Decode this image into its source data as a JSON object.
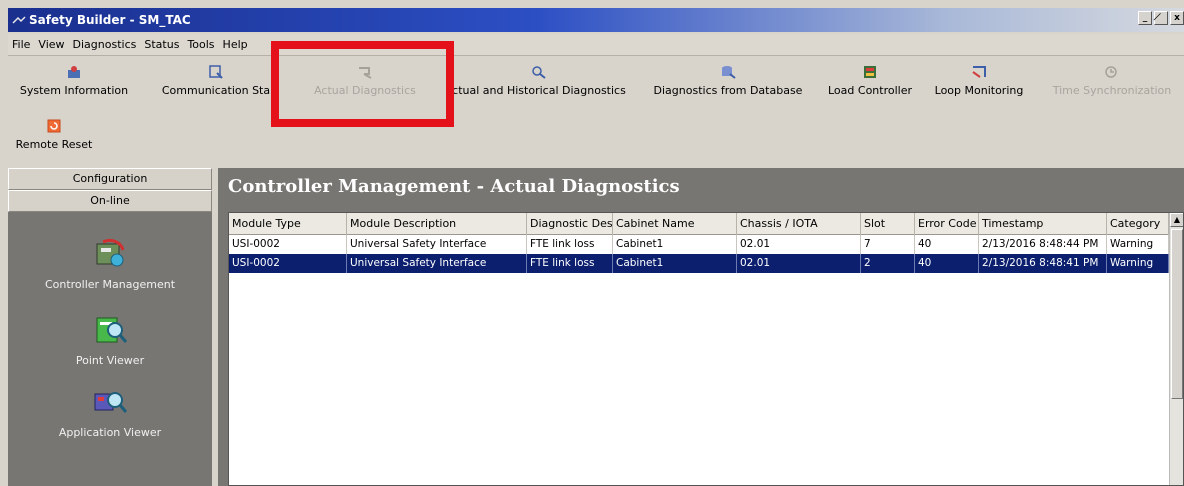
{
  "window": {
    "title": "Safety Builder - SM_TAC",
    "controls": [
      "_",
      "̸",
      "x"
    ]
  },
  "menu": [
    "File",
    "View",
    "Diagnostics",
    "Status",
    "Tools",
    "Help"
  ],
  "toolbar": [
    {
      "label": "System Information",
      "icon": "system-information-icon",
      "enabled": true
    },
    {
      "label": "Communication Sta",
      "icon": "communication-status-icon",
      "enabled": true
    },
    {
      "label": "Actual Diagnostics",
      "icon": "actual-diagnostics-icon",
      "enabled": false
    },
    {
      "label": "ctual and Historical Diagnostics",
      "icon": "historical-diagnostics-icon",
      "enabled": true
    },
    {
      "label": "Diagnostics from Database",
      "icon": "database-diagnostics-icon",
      "enabled": true
    },
    {
      "label": "Load Controller",
      "icon": "load-controller-icon",
      "enabled": true
    },
    {
      "label": "Loop Monitoring",
      "icon": "loop-monitoring-icon",
      "enabled": true
    },
    {
      "label": "Time Synchronization",
      "icon": "time-sync-icon",
      "enabled": false
    }
  ],
  "toolbar2": [
    {
      "label": "Remote Reset",
      "icon": "remote-reset-icon",
      "enabled": true
    }
  ],
  "highlight_color": "#e4111b",
  "nav": {
    "tabs": [
      "Configuration",
      "On-line"
    ],
    "items": [
      {
        "label": "Controller Management",
        "icon": "controller-management-icon"
      },
      {
        "label": "Point Viewer",
        "icon": "point-viewer-icon"
      },
      {
        "label": "Application Viewer",
        "icon": "application-viewer-icon"
      }
    ]
  },
  "main": {
    "title": "Controller Management - Actual Diagnostics",
    "columns": [
      "Module Type",
      "Module Description",
      "Diagnostic Desc",
      "Cabinet Name",
      "Chassis / IOTA",
      "Slot",
      "Error Code",
      "Timestamp",
      "Category"
    ],
    "rows": [
      [
        "USI-0002",
        "Universal Safety Interface",
        "FTE link loss",
        "Cabinet1",
        "02.01",
        "7",
        "40",
        "2/13/2016 8:48:44 PM",
        "Warning"
      ],
      [
        "USI-0002",
        "Universal Safety Interface",
        "FTE link loss",
        "Cabinet1",
        "02.01",
        "2",
        "40",
        "2/13/2016 8:48:41 PM",
        "Warning"
      ]
    ],
    "selected_row": 1
  }
}
